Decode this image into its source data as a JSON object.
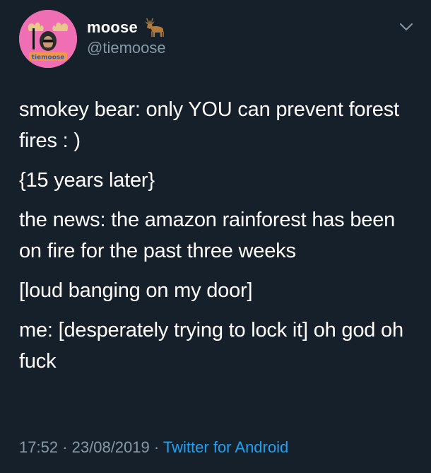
{
  "user": {
    "display_name": "moose",
    "handle": "@tiemoose",
    "avatar_badge_text": "tiemoose",
    "name_emoji": "moose-emoji"
  },
  "tweet": {
    "paragraphs": [
      "smokey bear: only YOU can prevent forest fires : )",
      "{15 years later}",
      "the news: the amazon rainforest has been on fire for the past three weeks",
      "[loud banging on my door]",
      "me: [desperately trying to lock it] oh god oh fuck"
    ],
    "time": "17:52",
    "separator": "·",
    "date": "23/08/2019",
    "source": "Twitter for Android"
  },
  "icons": {
    "menu": "chevron-down-icon"
  },
  "colors": {
    "background": "#15202b",
    "text": "#ffffff",
    "secondary_text": "#8899a6",
    "link": "#1da1f2",
    "avatar_bg": "#f06fb4"
  }
}
